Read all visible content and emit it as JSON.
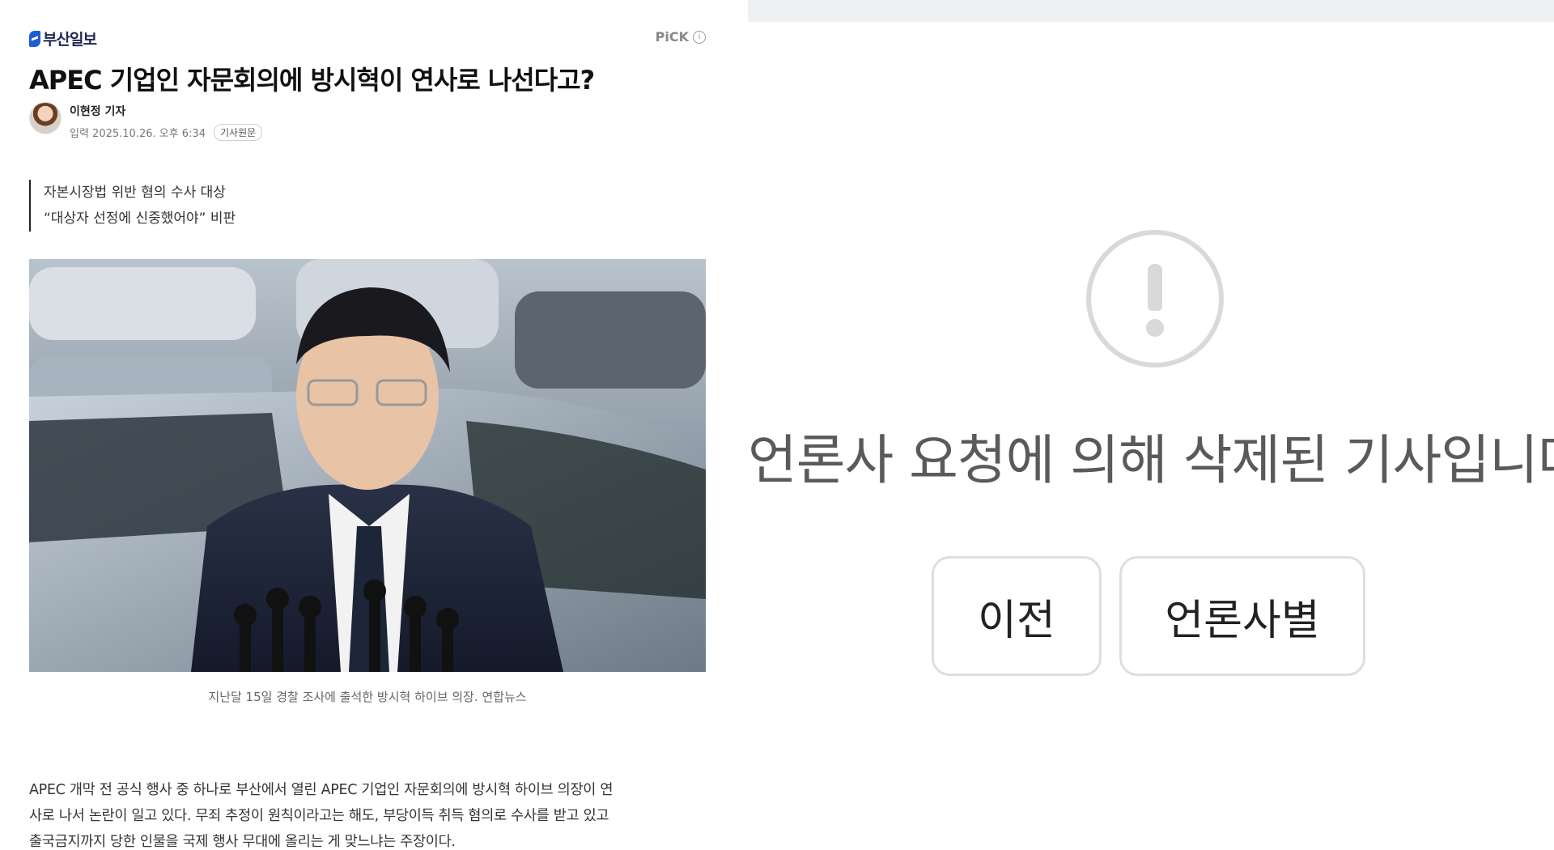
{
  "article": {
    "press_name": "부산일보",
    "pick_label": "PiCK",
    "pick_info_glyph": "i",
    "headline": "APEC 기업인 자문회의에 방시혁이 연사로 나선다고?",
    "reporter": "이현정 기자",
    "date_text": "입력 2025.10.26. 오후 6:34",
    "original_link_label": "기사원문",
    "subtitle_lines": [
      "자본시장법 위반 혐의 수사 대상",
      "“대상자 선정에 신중했어야” 비판"
    ],
    "photo_caption": "지난달 15일 경찰 조사에 출석한 방시혁 하이브 의장. 연합뉴스",
    "body_lines": [
      "APEC 개막 전 공식 행사 중 하나로 부산에서 열린 APEC 기업인 자문회의에 방시혁 하이브 의장이 연",
      "사로 나서 논란이 일고 있다. 무죄 추정이 원칙이라고는 해도, 부당이득 취득 혐의로 수사를 받고 있고",
      "출국금지까지 당한 인물을 국제 행사 무대에 올리는 게 맞느냐는 주장이다."
    ]
  },
  "notice": {
    "message": "언론사 요청에 의해 삭제된 기사입니다.",
    "icon": "exclamation-circle-icon",
    "prev_button": "이전",
    "press_button": "언론사별"
  },
  "colors": {
    "logo_blue": "#1f5bd6",
    "icon_gray": "#d9d9d9",
    "notice_text": "#5a5a5a",
    "top_strip": "#eef0f3"
  }
}
